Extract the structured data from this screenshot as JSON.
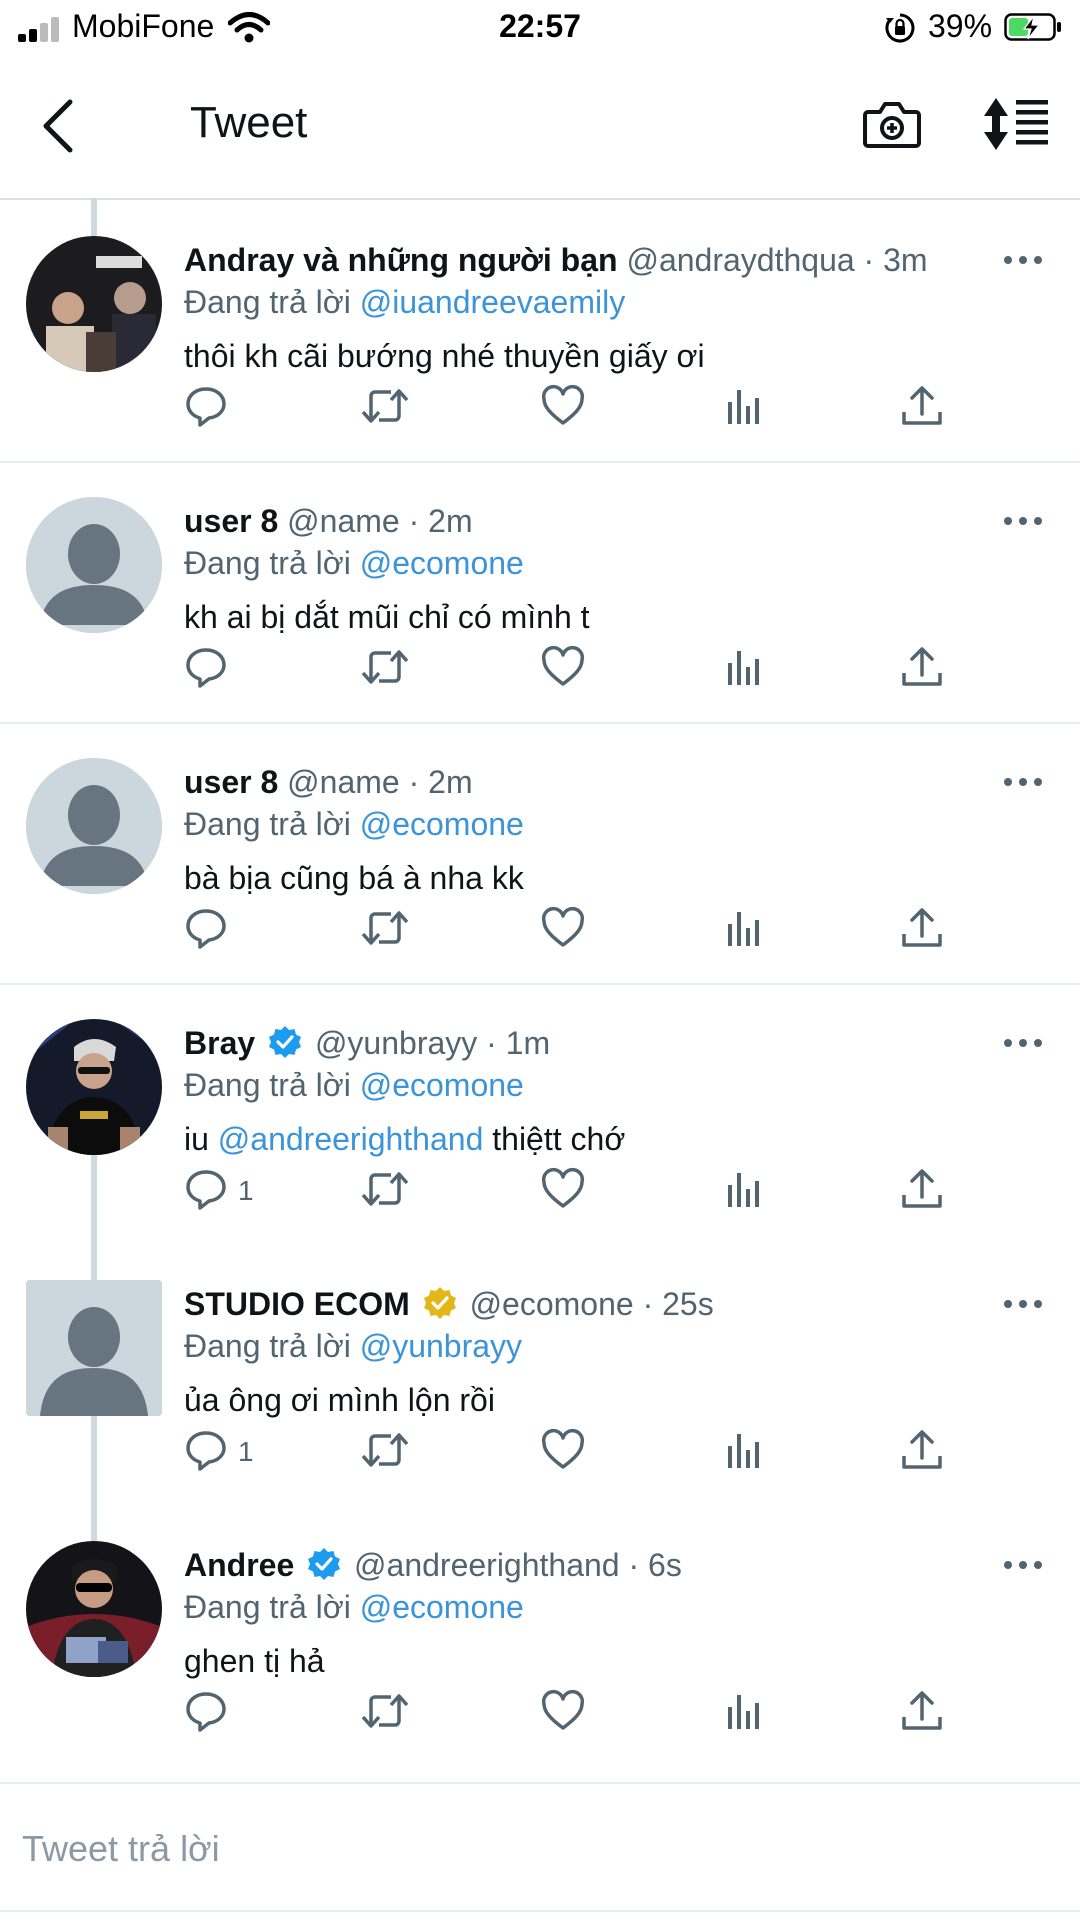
{
  "status_bar": {
    "carrier": "MobiFone",
    "time": "22:57",
    "battery": "39%"
  },
  "header": {
    "title": "Tweet",
    "back_icon": "chevron-left-icon",
    "camera_icon": "camera-plus-icon",
    "sort_icon": "sort-icon"
  },
  "tweets": [
    {
      "name": "Andray và những người bạn",
      "verified": "",
      "handle": "@andraydthqua",
      "time": "· 3m",
      "reply_prefix": "Đang trả lời",
      "reply_to": "@iuandreevaemily",
      "text": "thôi kh cãi bướng nhé thuyền giấy ơi",
      "text_mention": "",
      "text_after": "",
      "reply_count": ""
    },
    {
      "name": "user 8",
      "verified": "",
      "handle": "@name",
      "time": "· 2m",
      "reply_prefix": "Đang trả lời",
      "reply_to": "@ecomone",
      "text": "kh ai bị dắt mũi chỉ có mình t",
      "text_mention": "",
      "text_after": "",
      "reply_count": ""
    },
    {
      "name": "user 8",
      "verified": "",
      "handle": "@name",
      "time": "· 2m",
      "reply_prefix": "Đang trả lời",
      "reply_to": "@ecomone",
      "text": "bà bịa cũng bá à nha kk",
      "text_mention": "",
      "text_after": "",
      "reply_count": ""
    },
    {
      "name": "Bray",
      "verified": "blue",
      "handle": "@yunbrayy",
      "time": "· 1m",
      "reply_prefix": "Đang trả lời",
      "reply_to": "@ecomone",
      "text": "iu ",
      "text_mention": "@andreerighthand",
      "text_after": " thiệtt chớ",
      "reply_count": "1"
    },
    {
      "name": "STUDIO ECOM",
      "verified": "gold",
      "handle": "@ecomone",
      "time": "· 25s",
      "reply_prefix": "Đang trả lời",
      "reply_to": "@yunbrayy",
      "text": "ủa ông ơi mình lộn rồi",
      "text_mention": "",
      "text_after": "",
      "reply_count": "1"
    },
    {
      "name": "Andree",
      "verified": "blue",
      "handle": "@andreerighthand",
      "time": "· 6s",
      "reply_prefix": "Đang trả lời",
      "reply_to": "@ecomone",
      "text": "ghen tị hả",
      "text_mention": "",
      "text_after": "",
      "reply_count": ""
    }
  ],
  "reply_bar": {
    "placeholder": "Tweet trả lời"
  },
  "colors": {
    "mention": "#3b94d9",
    "verified_blue": "#1d9bf0",
    "verified_gold": "#e2b719",
    "icon_gray": "#536471",
    "battery_green": "#4cd964"
  }
}
